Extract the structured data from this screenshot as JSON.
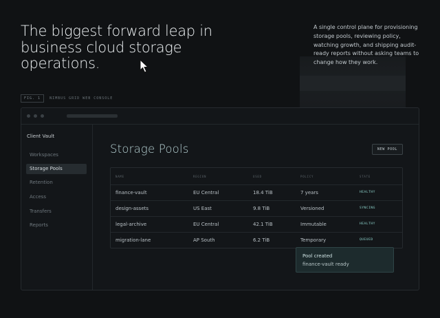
{
  "hero": {
    "title": "The biggest forward leap in business cloud storage operations.",
    "description": "A single control plane for provisioning storage pools, reviewing policy, watching growth, and shipping audit-ready reports without asking teams to change how they work."
  },
  "figure": {
    "tag": "FIG. 1",
    "label": "NIMBUS GRID WEB CONSOLE"
  },
  "sidebar": {
    "workspace": "Client Vault",
    "items": [
      {
        "label": "Workspaces",
        "active": false
      },
      {
        "label": "Storage Pools",
        "active": true
      },
      {
        "label": "Retention",
        "active": false
      },
      {
        "label": "Access",
        "active": false
      },
      {
        "label": "Transfers",
        "active": false
      },
      {
        "label": "Reports",
        "active": false
      }
    ]
  },
  "main": {
    "title": "Storage Pools",
    "new_button": "NEW POOL",
    "columns": [
      "NAME",
      "REGION",
      "USED",
      "POLICY",
      "STATE"
    ],
    "rows": [
      {
        "name": "finance-vault",
        "region": "EU Central",
        "used": "18.4 TiB",
        "policy": "7 years",
        "state": "HEALTHY"
      },
      {
        "name": "design-assets",
        "region": "US East",
        "used": "9.8 TiB",
        "policy": "Versioned",
        "state": "SYNCING"
      },
      {
        "name": "legal-archive",
        "region": "EU Central",
        "used": "42.1 TiB",
        "policy": "Immutable",
        "state": "HEALTHY"
      },
      {
        "name": "migration-lane",
        "region": "AP South",
        "used": "6.2 TiB",
        "policy": "Temporary",
        "state": "QUEUED"
      }
    ]
  },
  "toast": {
    "title": "Pool created",
    "message": "finance-vault ready"
  },
  "colors": {
    "background": "#101214",
    "accent": "#8fd6cf",
    "toast_bg": "#1d2b2d"
  }
}
